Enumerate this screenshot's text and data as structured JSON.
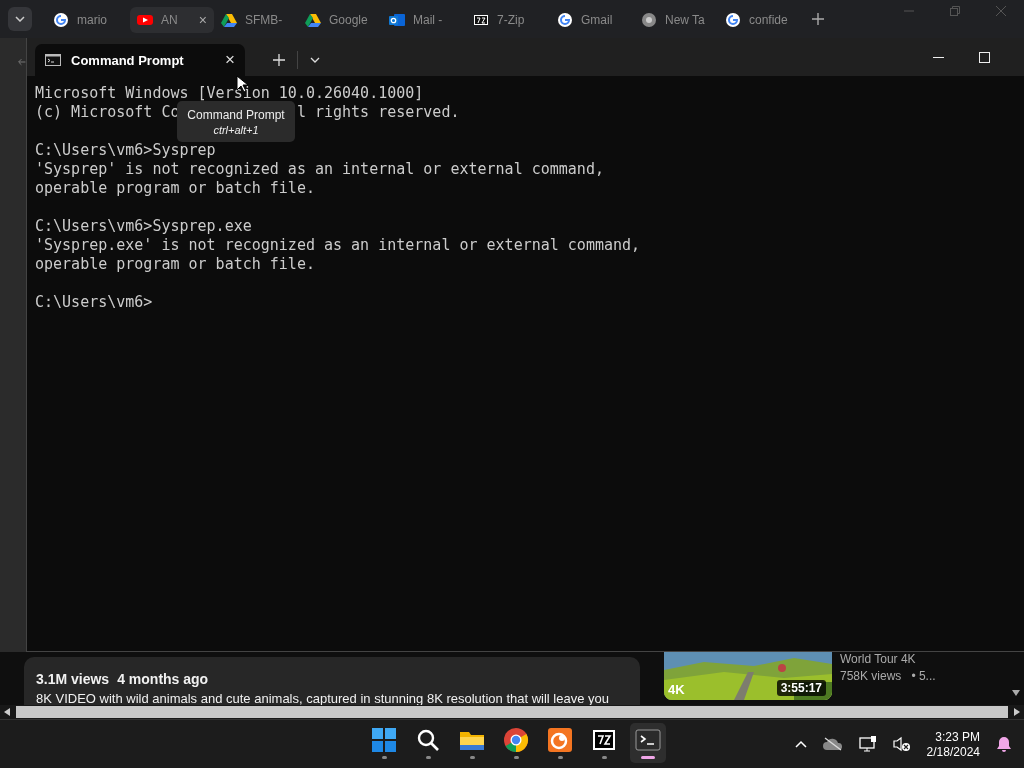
{
  "browser_tabs": [
    {
      "label": "mario",
      "kind": "google",
      "selected": false
    },
    {
      "label": "AN",
      "kind": "youtube",
      "selected": true,
      "close": "×"
    },
    {
      "label": "SFMB-",
      "kind": "drive",
      "selected": false
    },
    {
      "label": "Google",
      "kind": "drive",
      "selected": false
    },
    {
      "label": "Mail - ",
      "kind": "outlook",
      "selected": false
    },
    {
      "label": "7-Zip",
      "kind": "archive",
      "selected": false
    },
    {
      "label": "Gmail",
      "kind": "google",
      "selected": false
    },
    {
      "label": "New Ta",
      "kind": "chrome",
      "selected": false
    },
    {
      "label": "confide",
      "kind": "google",
      "selected": false
    }
  ],
  "terminal": {
    "tab": {
      "title": "Command Prompt",
      "close": "×"
    },
    "tooltip": {
      "title": "Command Prompt",
      "shortcut": "ctrl+alt+1"
    },
    "blocks": [
      [
        [
          "Microsoft Windows [Version 10.0.26040.1000]"
        ],
        [
          "(c) Microsoft Co",
          "l rights reserved."
        ]
      ],
      [
        [
          "C:\\Users\\vm6>Sysprep"
        ],
        [
          "'Sysprep' is not recognized as an internal or external command,"
        ],
        [
          "operable program or batch file."
        ]
      ],
      [
        [
          "C:\\Users\\vm6>Sysprep.exe"
        ],
        [
          "'Sysprep.exe' is not recognized as an internal or external command,"
        ],
        [
          "operable program or batch file."
        ]
      ],
      [
        [
          "C:\\Users\\vm6>"
        ]
      ]
    ]
  },
  "video": {
    "views": "3.1M views",
    "age": "4 months ago",
    "description": "8K VIDEO with wild animals and cute animals, captured in stunning 8K resolution that will leave you"
  },
  "related": {
    "thumbnail": {
      "kind": "picture",
      "quality": "4K",
      "duration": "3:55:17"
    },
    "title": "World Tour 4K",
    "views": "758K views",
    "meta": "• 5..."
  },
  "taskbar": {
    "apps": [
      {
        "kind": "windows",
        "selected": false
      },
      {
        "kind": "search",
        "selected": false
      },
      {
        "kind": "folder",
        "selected": false
      },
      {
        "kind": "chrome",
        "selected": false
      },
      {
        "kind": "crunchyroll",
        "selected": false
      },
      {
        "kind": "archive",
        "selected": false
      },
      {
        "kind": "terminal",
        "selected": true
      }
    ],
    "time": "3:23 PM",
    "date": "2/18/2024"
  }
}
